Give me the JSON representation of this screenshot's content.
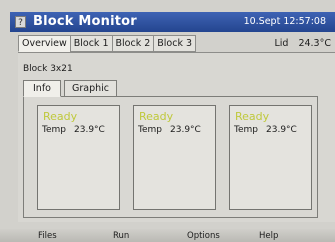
{
  "header": {
    "icon": "?",
    "title": "Block Monitor",
    "datetime": "10.Sept 12:57:08"
  },
  "top_tabs": [
    "Overview",
    "Block 1",
    "Block 2",
    "Block 3"
  ],
  "status": {
    "lid_label": "Lid",
    "temperature": "24.3°C"
  },
  "block_name": "Block 3x21",
  "inner_tabs": [
    "Info",
    "Graphic"
  ],
  "cards": [
    {
      "status": "Ready",
      "temp_label": "Temp",
      "temp_value": "23.9°C"
    },
    {
      "status": "Ready",
      "temp_label": "Temp",
      "temp_value": "23.9°C"
    },
    {
      "status": "Ready",
      "temp_label": "Temp",
      "temp_value": "23.9°C"
    }
  ],
  "menu": [
    "Files",
    "Run",
    "Options",
    "Help"
  ],
  "colors": {
    "title_bar": "#24458f",
    "ready_status": "#bfc93c"
  }
}
